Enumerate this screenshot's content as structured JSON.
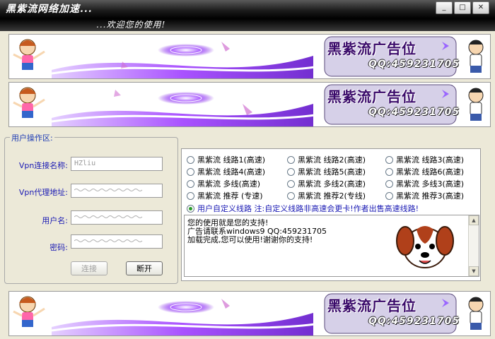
{
  "window": {
    "title": "黑紫流网络加速...",
    "subtitle": "...欢迎您的使用!",
    "min": "_",
    "max": "□",
    "close": "✕"
  },
  "ad": {
    "title": "黑紫流广告位",
    "qq": "QQ:459231705"
  },
  "form": {
    "group_label": "用户操作区:",
    "name_label": "Vpn连接名称:",
    "name_value": "HZliu",
    "proxy_label": "Vpn代理地址:",
    "user_label": "用户名:",
    "pass_label": "密码:",
    "connect": "连接",
    "disconnect": "断开"
  },
  "routes": [
    "黑紫流 线路1(高速)",
    "黑紫流 线路2(高速)",
    "黑紫流 线路3(高速)",
    "黑紫流 线路4(高速)",
    "黑紫流 线路5(高速)",
    "黑紫流 线路6(高速)",
    "黑紫流 多线(高速)",
    "黑紫流 多线2(高速)",
    "黑紫流 多线3(高速)",
    "黑紫流 推荐 (专速)",
    "黑紫流 推荐2(专线)",
    "黑紫流 推荐3(高速)"
  ],
  "custom_route": "用户自定义线路 注:自定义线路非高速会更卡!作者出售高速线路!",
  "log": [
    "您的使用就是您的支持!",
    "广告请联系windows9 QQ:459231705",
    "加载完成,您可以使用!谢谢你的支持!"
  ],
  "colors": {
    "accent_text": "#1a1ab4",
    "banner_purple": "#8a2be2",
    "titlebar": "#000000"
  }
}
